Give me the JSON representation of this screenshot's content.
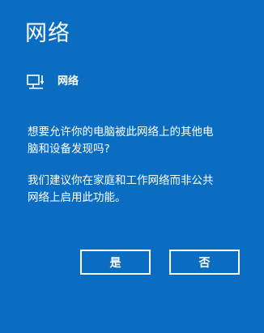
{
  "dialog": {
    "title": "网络",
    "network_name": "网络",
    "icon": "wired-network-icon",
    "question_line1": "想要允许你的电脑被此网络上的其他电",
    "question_line2": "脑和设备发现吗?",
    "recommendation_line1": "我们建议你在家庭和工作网络而非公共",
    "recommendation_line2": "网络上启用此功能。",
    "yes_label": "是",
    "no_label": "否"
  },
  "colors": {
    "background": "#0b6dc1",
    "text": "#ffffff",
    "button_border": "#ffffff"
  }
}
